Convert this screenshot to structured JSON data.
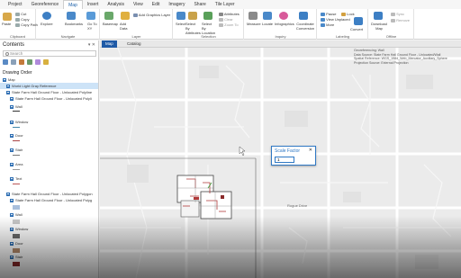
{
  "ribbon": {
    "tabs": [
      "Project",
      "Georeference",
      "Map",
      "Insert",
      "Analysis",
      "View",
      "Edit",
      "Imagery",
      "Share",
      "Tile Layer"
    ],
    "active_tab": "Map",
    "clipboard": {
      "paste": "Paste",
      "cut": "Cut",
      "copy": "Copy",
      "copy_path": "Copy Path",
      "label": "Clipboard"
    },
    "navigate": {
      "explore": "Explore",
      "bookmarks": "Bookmarks",
      "goto": "Go To XY",
      "label": "Navigate"
    },
    "layer": {
      "basemap": "Basemap",
      "add_data": "Add Data",
      "add_graphics": "Add Graphics Layer",
      "label": "Layer"
    },
    "selection": {
      "select": "Select",
      "by_attr": "Select By Attributes",
      "by_loc": "Select By Location",
      "attributes": "Attributes",
      "clear": "Clear",
      "zoom_to": "Zoom To",
      "label": "Selection"
    },
    "inquiry": {
      "measure": "Measure",
      "locate": "Locate",
      "infographics": "Infographics",
      "coord": "Coordinate Conversion",
      "label": "Inquiry"
    },
    "labeling": {
      "pause": "Pause",
      "lock": "Lock",
      "view_unplaced": "View Unplaced",
      "more": "More",
      "convert": "Convert",
      "label": "Labeling"
    },
    "offline": {
      "download": "Download Map",
      "sync": "Sync",
      "remove": "Remove",
      "label": "Offline"
    }
  },
  "contents": {
    "title": "Contents",
    "search_placeholder": "Search",
    "drawing_order": "Drawing Order",
    "items": [
      {
        "text": "Map"
      },
      {
        "text": "World Light Gray Reference"
      },
      {
        "text": "State Farm Hall Ground Floor - Unlocated Polyline"
      },
      {
        "text": "State Farm Hall Ground Floor - Unlocated Polyli"
      },
      {
        "text": "Wall"
      },
      {
        "text": "Window"
      },
      {
        "text": "Door"
      },
      {
        "text": "Stair"
      },
      {
        "text": "Area"
      },
      {
        "text": "Text"
      },
      {
        "text": "State Farm Hall Ground Floor - Unlocated Polygon"
      },
      {
        "text": "State Farm Hall Ground Floor - Unlocated Polyg"
      },
      {
        "text": "Wall"
      },
      {
        "text": "Window"
      },
      {
        "text": "Door"
      },
      {
        "text": "Stair"
      }
    ]
  },
  "map_tabs": {
    "map": "Map",
    "catalog": "Catalog"
  },
  "selection_panel": {
    "heading": "Georeferencing: Wall",
    "line1": "Data Source: State Farm Hall Ground Floor - Unlocated/Wall",
    "line2": "Spatial Reference: WGS_1984_Web_Mercator_Auxiliary_Sphere",
    "line3": "Projection Source: External Projection"
  },
  "scale_dialog": {
    "title": "Scale Factor",
    "close": "✕",
    "value": "1"
  },
  "map_labels": {
    "road": "Rogue Drive"
  },
  "colors": {
    "accent": "#1f5aa6",
    "floorplan": "#b03a3a",
    "paper": "#ffffff"
  }
}
